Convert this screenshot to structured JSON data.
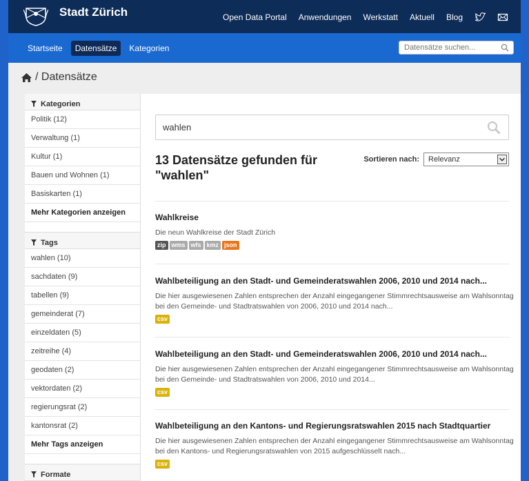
{
  "header": {
    "brand": "Stadt Zürich",
    "links": [
      "Open Data Portal",
      "Anwendungen",
      "Werkstatt",
      "Aktuell",
      "Blog"
    ]
  },
  "navbar": {
    "items": [
      "Startseite",
      "Datensätze",
      "Kategorien"
    ],
    "active": "Datensätze",
    "search_placeholder": "Datensätze suchen..."
  },
  "breadcrumb": {
    "current": "/ Datensätze"
  },
  "sidebar": {
    "categories_title": "Kategorien",
    "categories": [
      "Politik (12)",
      "Verwaltung (1)",
      "Kultur (1)",
      "Bauen und Wohnen (1)",
      "Basiskarten (1)"
    ],
    "more_categories": "Mehr Kategorien anzeigen",
    "tags_title": "Tags",
    "tags": [
      "wahlen (10)",
      "sachdaten (9)",
      "tabellen (9)",
      "gemeinderat (7)",
      "einzeldaten (5)",
      "zeitreihe (4)",
      "geodaten (2)",
      "vektordaten (2)",
      "regierungsrat (2)",
      "kantonsrat (2)"
    ],
    "more_tags": "Mehr Tags anzeigen",
    "formats_title": "Formate"
  },
  "main": {
    "search_value": "wahlen",
    "results_title": "13 Datensätze gefunden für \"wahlen\"",
    "sort_label": "Sortieren nach:",
    "sort_value": "Relevanz",
    "datasets": [
      {
        "title": "Wahlkreise",
        "desc": "Die neun Wahlkreise der Stadt Zürich",
        "formats": [
          "zip",
          "wms",
          "wfs",
          "kmz",
          "json"
        ]
      },
      {
        "title": "Wahlbeteiligung an den Stadt- und Gemeinderatswahlen 2006, 2010 und 2014 nach...",
        "desc": "Die hier ausgewiesenen Zahlen entsprechen der Anzahl eingegangener Stimmrechtsausweise am Wahlsonntag bei den Gemeinde- und Stadtratswahlen von 2006, 2010 und 2014 nach...",
        "formats": [
          "csv"
        ]
      },
      {
        "title": "Wahlbeteiligung an den Stadt- und Gemeinderatswahlen 2006, 2010 und 2014 nach...",
        "desc": "Die hier ausgewiesenen Zahlen entsprechen der Anzahl eingegangener Stimmrechtsausweise am Wahlsonntag bei den Gemeinde- und Stadtratswahlen von 2006, 2010 und 2014...",
        "formats": [
          "csv"
        ]
      },
      {
        "title": "Wahlbeteiligung an den Kantons- und Regierungsratswahlen 2015 nach Stadtquartier",
        "desc": "Die hier ausgewiesenen Zahlen entsprechen der Anzahl eingegangener Stimmrechtsausweise am Wahlsonntag bei den Kantons- und Regierungsratswahlen von 2015 aufgeschlüsselt nach...",
        "formats": [
          "csv"
        ]
      }
    ]
  },
  "colors": {
    "topbar": "#0d2c58",
    "navbar": "#1a69d0",
    "json_badge": "#e8761d",
    "csv_badge": "#dab20c"
  }
}
